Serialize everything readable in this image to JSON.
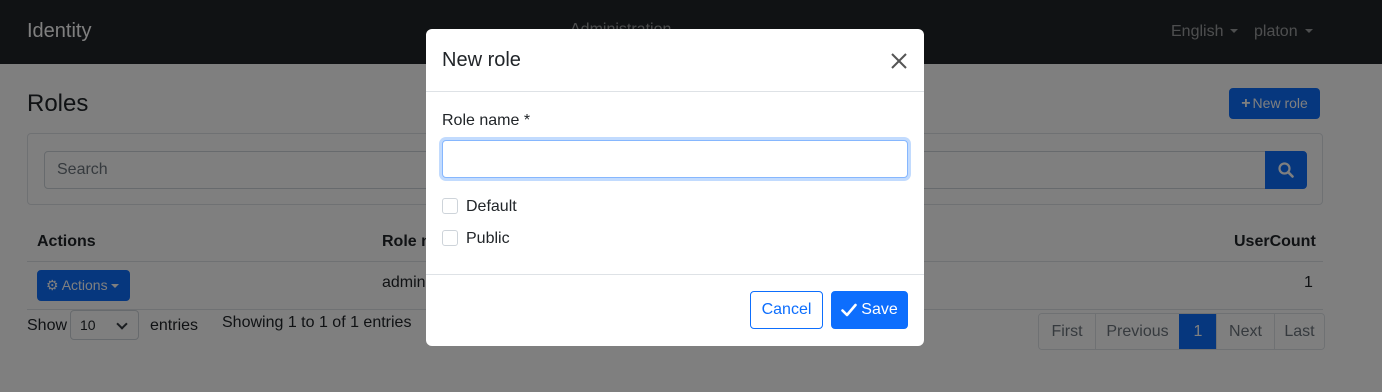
{
  "navbar": {
    "brand": "Identity",
    "center_item": "Administration",
    "language": "English",
    "user": "platon"
  },
  "page": {
    "title": "Roles",
    "new_role_button": "New role",
    "search_placeholder": "Search"
  },
  "table": {
    "columns": [
      "Actions",
      "Role name",
      "UserCount"
    ],
    "rows": [
      {
        "actions_label": "Actions",
        "role_name": "admin",
        "user_count": "1"
      }
    ]
  },
  "footer": {
    "show_label": "Show",
    "page_size": "10",
    "entries_label": "entries",
    "info": "Showing 1 to 1 of 1 entries"
  },
  "pagination": {
    "items": [
      "First",
      "Previous",
      "1",
      "Next",
      "Last"
    ],
    "active": "1"
  },
  "modal": {
    "title": "New role",
    "role_name_label": "Role name *",
    "role_name_value": "",
    "checkboxes": [
      {
        "label": "Default",
        "checked": false
      },
      {
        "label": "Public",
        "checked": false
      }
    ],
    "cancel_label": "Cancel",
    "save_label": "Save"
  },
  "colors": {
    "primary": "#0d6efd",
    "navbar": "#212529",
    "backdrop": "rgba(0,0,0,0.5)"
  }
}
